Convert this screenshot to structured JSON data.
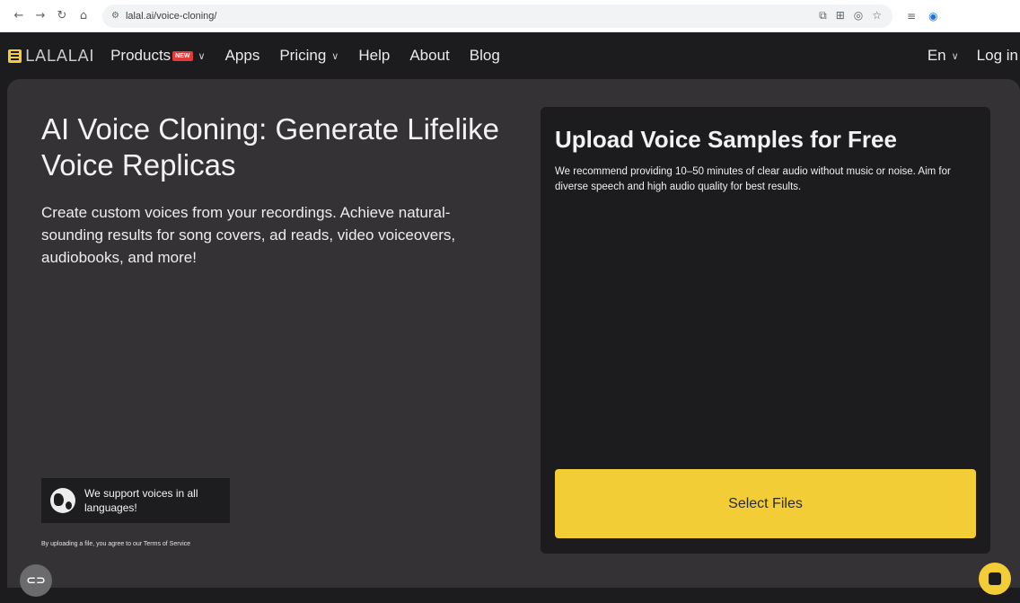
{
  "browser": {
    "url": "lalal.ai/voice-cloning/",
    "icons": [
      "back-arrow-icon",
      "forward-arrow-icon",
      "reload-icon",
      "home-icon",
      "site-info-icon",
      "open-in-app-icon",
      "translate-icon",
      "eye-off-icon",
      "bookmark-star-icon",
      "reading-list-icon",
      "profile-icon"
    ]
  },
  "nav": {
    "logo_text": "LALALAI",
    "items": [
      {
        "label": "Products",
        "badge": "NEW",
        "has_dropdown": true
      },
      {
        "label": "Apps"
      },
      {
        "label": "Pricing",
        "has_dropdown": true
      },
      {
        "label": "Help"
      },
      {
        "label": "About"
      },
      {
        "label": "Blog"
      }
    ],
    "language": "En",
    "login": "Log in"
  },
  "hero": {
    "title": "AI Voice Cloning: Generate Lifelike Voice Replicas",
    "subtitle": "Create custom voices from your recordings. Achieve natural-sounding results for song covers, ad reads, video voiceovers, audiobooks, and more!",
    "languages_note": "We support voices in all languages!",
    "terms": "By uploading a file, you agree to our Terms of Service"
  },
  "upload": {
    "title": "Upload Voice Samples for Free",
    "description": "We recommend providing 10–50 minutes of clear audio without music or noise. Aim for diverse speech and high audio quality for best results.",
    "button": "Select Files"
  },
  "colors": {
    "accent": "#f3cd36",
    "background": "#1c1b1d",
    "panel": "#343234",
    "badge": "#e53a3a"
  }
}
